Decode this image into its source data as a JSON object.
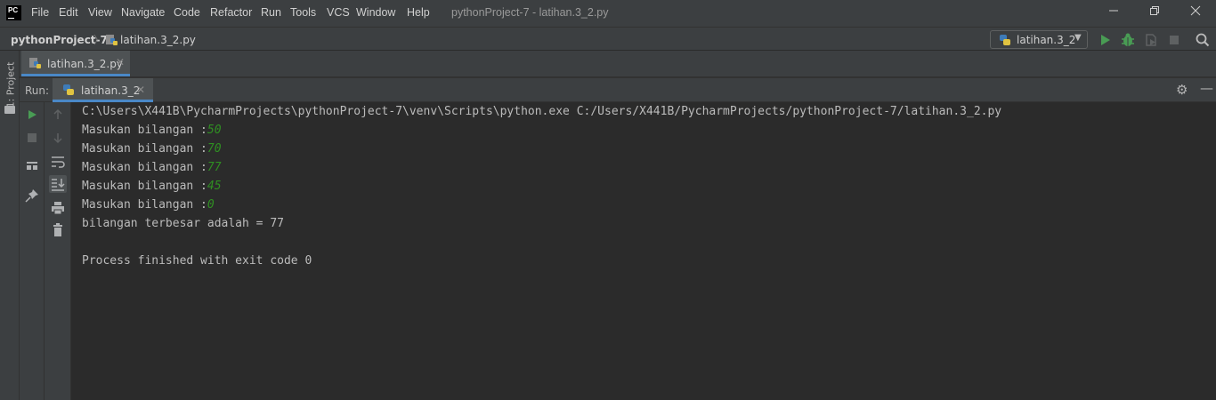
{
  "titlebar": {
    "menu": [
      "File",
      "Edit",
      "View",
      "Navigate",
      "Code",
      "Refactor",
      "Run",
      "Tools",
      "VCS",
      "Window",
      "Help"
    ],
    "window_title": "pythonProject-7 - latihan.3_2.py"
  },
  "navbar": {
    "project": "pythonProject-7",
    "file": "latihan.3_2.py",
    "run_config": "latihan.3_2"
  },
  "left_stripe": {
    "project_tab": "1: Project"
  },
  "editor_tabs": [
    {
      "label": "latihan.3_2.py"
    }
  ],
  "run_panel": {
    "label": "Run:",
    "tab": "latihan.3_2"
  },
  "console": {
    "command": "C:\\Users\\X441B\\PycharmProjects\\pythonProject-7\\venv\\Scripts\\python.exe C:/Users/X441B/PycharmProjects/pythonProject-7/latihan.3_2.py",
    "prompt": "Masukan bilangan :",
    "inputs": [
      "50",
      "70",
      "77",
      "45",
      "0"
    ],
    "result": "bilangan terbesar adalah = 77",
    "exit": "Process finished with exit code 0"
  },
  "colors": {
    "accent": "#4a88c7",
    "run_green": "#499c54",
    "input_green": "#2f8f22",
    "background": "#2b2b2b"
  },
  "icons": [
    "pycharm-logo",
    "python-file-icon",
    "run-icon",
    "debug-icon",
    "coverage-icon",
    "stop-icon",
    "search-icon",
    "gear-icon",
    "minimize-icon",
    "folder-icon",
    "up-arrow-icon",
    "down-arrow-icon",
    "soft-wrap-icon",
    "scroll-to-end-icon",
    "print-icon",
    "trash-icon",
    "layout-icon",
    "pin-icon"
  ]
}
